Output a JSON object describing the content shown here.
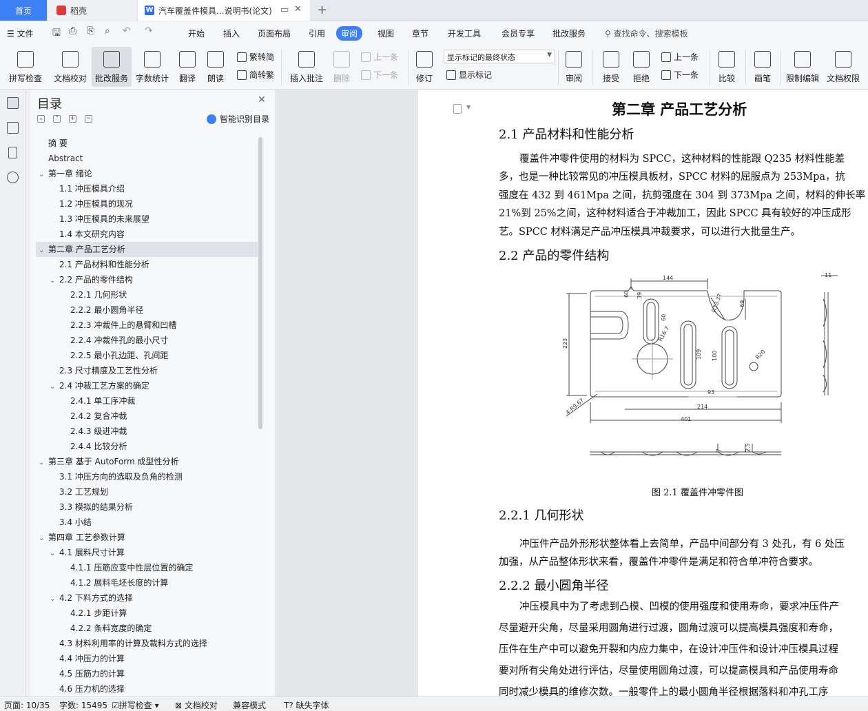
{
  "tabs": {
    "home": "首页",
    "wps": "稻壳",
    "doc": "汽车覆盖件模具...说明书(论文)"
  },
  "menu": {
    "file": "文件",
    "items": [
      "开始",
      "插入",
      "页面布局",
      "引用",
      "审阅",
      "视图",
      "章节",
      "开发工具",
      "会员专享",
      "批改服务"
    ],
    "search": "查找命令、搜索模板"
  },
  "ribbon": {
    "spell": "拼写检查",
    "proof": "文档校对",
    "revise_service": "批改服务",
    "wordcount": "字数统计",
    "translate": "翻译",
    "read": "朗读",
    "trad": "繁转简",
    "simp": "简转繁",
    "insert_comment": "插入批注",
    "delete": "删除",
    "prev": "上一条",
    "next": "下一条",
    "revise": "修订",
    "markup_state": "显示标记的最终状态",
    "show_markup": "显示标记",
    "review": "审阅",
    "accept": "接受",
    "reject": "拒绝",
    "prev2": "上一条",
    "next2": "下一条",
    "compare": "比较",
    "pen": "画笔",
    "restrict": "限制编辑",
    "perm": "文档权限"
  },
  "toc": {
    "title": "目录",
    "smart": "智能识别目录",
    "items": [
      {
        "label": "摘  要",
        "level": 1,
        "caret": ""
      },
      {
        "label": "Abstract",
        "level": 1,
        "caret": ""
      },
      {
        "label": "第一章  绪论",
        "level": 1,
        "caret": "v"
      },
      {
        "label": "1.1 冲压模具介绍",
        "level": 2,
        "caret": ""
      },
      {
        "label": "1.2 冲压模具的现况",
        "level": 2,
        "caret": ""
      },
      {
        "label": "1.3 冲压模具的未来展望",
        "level": 2,
        "caret": ""
      },
      {
        "label": "1.4 本文研究内容",
        "level": 2,
        "caret": ""
      },
      {
        "label": "第二章  产品工艺分析",
        "level": 1,
        "caret": "v"
      },
      {
        "label": "2.1 产品材料和性能分析",
        "level": 2,
        "caret": ""
      },
      {
        "label": "2.2 产品的零件结构",
        "level": 2,
        "caret": "v"
      },
      {
        "label": "2.2.1  几何形状",
        "level": 3,
        "caret": ""
      },
      {
        "label": "2.2.2 最小圆角半径",
        "level": 3,
        "caret": ""
      },
      {
        "label": "2.2.3 冲裁件上的悬臂和凹槽",
        "level": 3,
        "caret": ""
      },
      {
        "label": "2.2.4 冲裁件孔的最小尺寸",
        "level": 3,
        "caret": ""
      },
      {
        "label": "2.2.5 最小孔边距、孔间距",
        "level": 3,
        "caret": ""
      },
      {
        "label": "2.3 尺寸精度及工艺性分析",
        "level": 2,
        "caret": ""
      },
      {
        "label": "2.4 冲裁工艺方案的确定",
        "level": 2,
        "caret": "v"
      },
      {
        "label": "2.4.1 单工序冲裁",
        "level": 3,
        "caret": ""
      },
      {
        "label": "2.4.2 复合冲裁",
        "level": 3,
        "caret": ""
      },
      {
        "label": "2.4.3 级进冲裁",
        "level": 3,
        "caret": ""
      },
      {
        "label": "2.4.4 比较分析",
        "level": 3,
        "caret": ""
      },
      {
        "label": "第三章  基于 AutoForm 成型性分析",
        "level": 1,
        "caret": "v"
      },
      {
        "label": "3.1  冲压方向的选取及负角的检测",
        "level": 2,
        "caret": ""
      },
      {
        "label": "3.2  工艺规划",
        "level": 2,
        "caret": ""
      },
      {
        "label": "3.3  模拟的结果分析",
        "level": 2,
        "caret": ""
      },
      {
        "label": "3.4  小结",
        "level": 2,
        "caret": ""
      },
      {
        "label": "第四章  工艺参数计算",
        "level": 1,
        "caret": "v"
      },
      {
        "label": "4.1 展料尺寸计算",
        "level": 2,
        "caret": "v"
      },
      {
        "label": "4.1.1 压筋应变中性层位置的确定",
        "level": 3,
        "caret": ""
      },
      {
        "label": "4.1.2 展料毛坯长度的计算",
        "level": 3,
        "caret": ""
      },
      {
        "label": "4.2 下料方式的选择",
        "level": 2,
        "caret": "v"
      },
      {
        "label": "4.2.1 步距计算",
        "level": 3,
        "caret": ""
      },
      {
        "label": "4.2.2 条料宽度的确定",
        "level": 3,
        "caret": ""
      },
      {
        "label": "4.3 材料利用率的计算及裁料方式的选择",
        "level": 2,
        "caret": ""
      },
      {
        "label": "4.4 冲压力的计算",
        "level": 2,
        "caret": ""
      },
      {
        "label": "4.5 压筋力的计算",
        "level": 2,
        "caret": ""
      },
      {
        "label": "4.6 压力机的选择",
        "level": 2,
        "caret": ""
      }
    ]
  },
  "doc": {
    "chapter": "第二章  产品工艺分析",
    "s21": "2.1 产品材料和性能分析",
    "s21_lines": [
      "覆盖件冲零件使用的材料为 SPCC，这种材料的性能跟 Q235 材料性能差",
      "多，也是一种比较常见的冲压模具板材，SPCC 材料的屈服点为 253Mpa，抗",
      "强度在 432 到 461Mpa 之间，抗剪强度在 304 到 373Mpa 之间，材料的伸长率",
      "21%到 25%之间，这种材料适合于冲裁加工，因此 SPCC 具有较好的冲压成形",
      "艺。SPCC 材料满足产品冲压模具冲裁要求，可以进行大批量生产。"
    ],
    "s22": "2.2 产品的零件结构",
    "figure_caption": "图 2.1  覆盖件冲零件图",
    "drawing_dims": [
      "144",
      "60",
      "39",
      "R33.37",
      "69",
      "223",
      "60",
      "R16.7",
      "109",
      "100",
      "R20",
      "93",
      "214",
      "401",
      "4-R9.67",
      "11",
      "7",
      "2.5"
    ],
    "s221": "2.2.1  几何形状",
    "s221_lines": [
      "冲压件产品外形形状整体看上去简单，产品中间部分有 3 处孔，有 6 处压",
      "加强，从产品整体形状来看，覆盖件冲零件是满足和符合单冲符合要求。"
    ],
    "s222": "2.2.2 最小圆角半径",
    "s222_lines": [
      "冲压模具中为了考虑到凸模、凹模的使用强度和使用寿命，要求冲压件产",
      "尽量避开尖角，尽量采用圆角进行过渡，圆角过渡可以提高模具强度和寿命，",
      "压件在生产中可以避免开裂和内应力集中，在设计冲压件和设计冲压模具过程",
      "要对所有尖角处进行评估，尽量使用圆角过渡，可以提高模具和产品使用寿命",
      "同时减少模具的维修次数。一般零件上的最小圆角半径根据落料和冲孔工序"
    ]
  },
  "status": {
    "page": "页面: 10/35",
    "words": "字数: 15495",
    "spell": "拼写检查",
    "proof": "文档校对",
    "compat": "兼容模式",
    "missing_font": "缺失字体"
  }
}
